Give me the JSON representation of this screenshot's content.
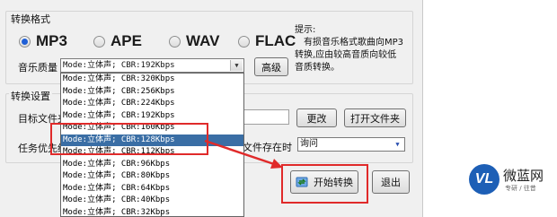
{
  "format_group": {
    "title": "转换格式",
    "options": [
      {
        "label": "MP3",
        "selected": true
      },
      {
        "label": "APE",
        "selected": false
      },
      {
        "label": "WAV",
        "selected": false
      },
      {
        "label": "FLAC",
        "selected": false
      }
    ],
    "quality_label": "音乐质量",
    "quality_value": "Mode:立体声; CBR:192Kbps",
    "advanced_button": "高级",
    "hint_lines": [
      "提示:",
      "有损音乐格式歌曲向MP3",
      "转换,应由较高音质向较低",
      "音质转换。"
    ]
  },
  "settings_group": {
    "title": "转换设置",
    "target_folder_label": "目标文件夹",
    "change_button": "更改",
    "open_folder_button": "打开文件夹",
    "priority_label": "任务优先级",
    "file_exists_label": "文件存在时",
    "file_exists_value": "询问"
  },
  "start_button": "开始转换",
  "exit_button": "退出",
  "dropdown_options": [
    "Mode:立体声; CBR:320Kbps",
    "Mode:立体声; CBR:256Kbps",
    "Mode:立体声; CBR:224Kbps",
    "Mode:立体声; CBR:192Kbps",
    "Mode:立体声; CBR:160Kbps",
    "Mode:立体声; CBR:128Kbps",
    "Mode:立体声; CBR:112Kbps",
    "Mode:立体声; CBR:96Kbps",
    "Mode:立体声; CBR:80Kbps",
    "Mode:立体声; CBR:64Kbps",
    "Mode:立体声; CBR:40Kbps",
    "Mode:立体声; CBR:32Kbps"
  ],
  "highlighted_option": "Mode:立体声; CBR:128Kbps",
  "watermark": {
    "logo_text": "VL",
    "name": "微蓝网",
    "tagline": "专研 / 往昔"
  },
  "colors": {
    "highlight": "#3a6ea5",
    "annotation_red": "#e02a2a",
    "logo_blue": "#1d5fb6"
  }
}
